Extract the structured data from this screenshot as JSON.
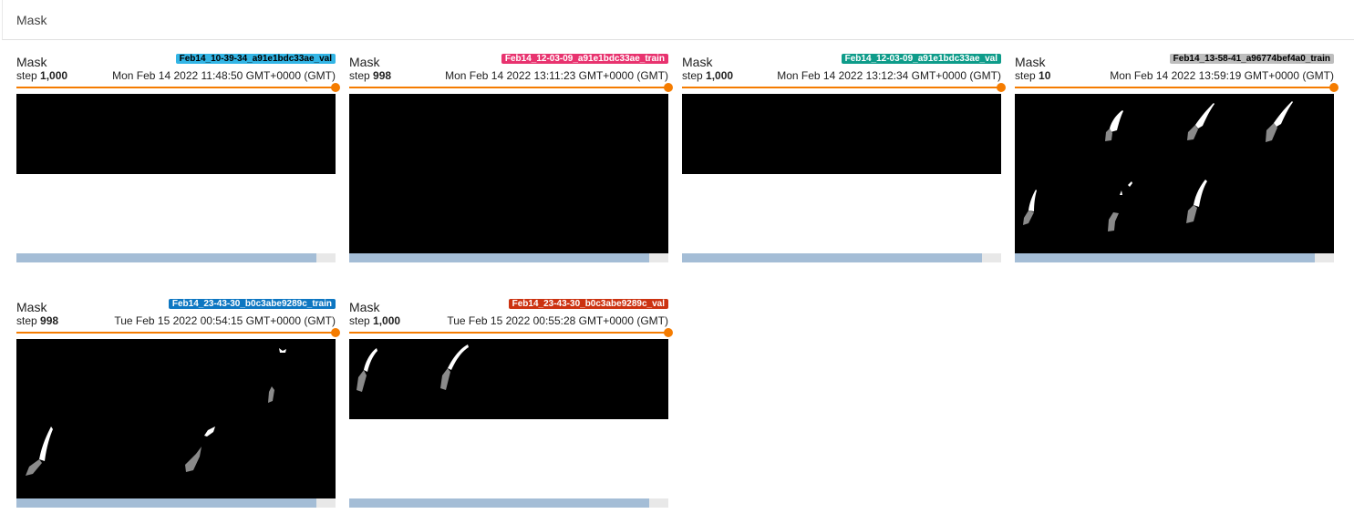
{
  "section": {
    "title": "Mask"
  },
  "cards": [
    {
      "title": "Mask",
      "run": "Feb14_10-39-34_a91e1bdc33ae_val",
      "run_color": "#33b5e5",
      "run_text_color": "#000000",
      "step_label": "step",
      "step": "1,000",
      "time": "Mon Feb 14 2022 11:48:50 GMT+0000 (GMT)",
      "slider_fraction": 1.0,
      "scroll_fraction": 0.94
    },
    {
      "title": "Mask",
      "run": "Feb14_12-03-09_a91e1bdc33ae_train",
      "run_color": "#e8336f",
      "run_text_color": "#ffffff",
      "step_label": "step",
      "step": "998",
      "time": "Mon Feb 14 2022 13:11:23 GMT+0000 (GMT)",
      "slider_fraction": 1.0,
      "scroll_fraction": 0.94
    },
    {
      "title": "Mask",
      "run": "Feb14_12-03-09_a91e1bdc33ae_val",
      "run_color": "#0e9c8a",
      "run_text_color": "#ffffff",
      "step_label": "step",
      "step": "1,000",
      "time": "Mon Feb 14 2022 13:12:34 GMT+0000 (GMT)",
      "slider_fraction": 1.0,
      "scroll_fraction": 0.94
    },
    {
      "title": "Mask",
      "run": "Feb14_13-58-41_a96774bef4a0_train",
      "run_color": "#bdbdbd",
      "run_text_color": "#000000",
      "step_label": "step",
      "step": "10",
      "time": "Mon Feb 14 2022 13:59:19 GMT+0000 (GMT)",
      "slider_fraction": 1.0,
      "scroll_fraction": 0.94
    },
    {
      "title": "Mask",
      "run": "Feb14_23-43-30_b0c3abe9289c_train",
      "run_color": "#0e77c2",
      "run_text_color": "#ffffff",
      "step_label": "step",
      "step": "998",
      "time": "Tue Feb 15 2022 00:54:15 GMT+0000 (GMT)",
      "slider_fraction": 1.0,
      "scroll_fraction": 0.94
    },
    {
      "title": "Mask",
      "run": "Feb14_23-43-30_b0c3abe9289c_val",
      "run_color": "#cc3311",
      "run_text_color": "#ffffff",
      "step_label": "step",
      "step": "1,000",
      "time": "Tue Feb 15 2022 00:55:28 GMT+0000 (GMT)",
      "slider_fraction": 1.0,
      "scroll_fraction": 0.94
    }
  ]
}
